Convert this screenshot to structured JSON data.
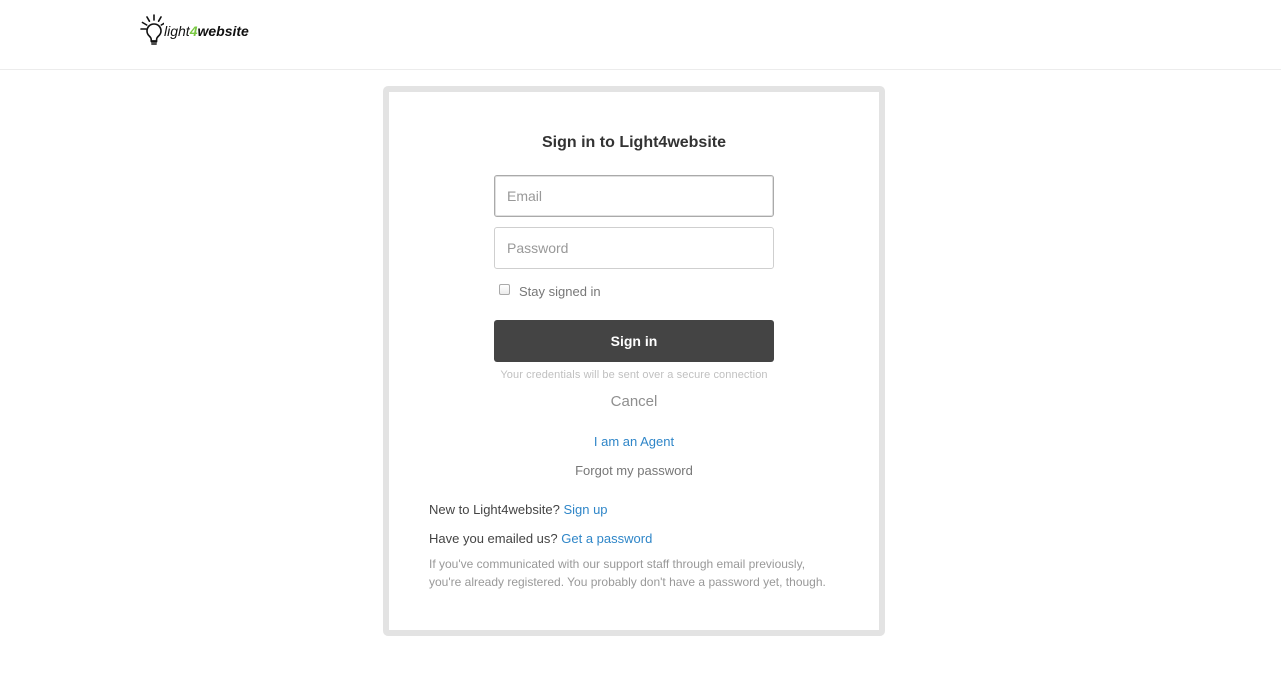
{
  "header": {
    "logo": {
      "text_light": "light",
      "text_four": "4",
      "text_website": "website",
      "icon": "lightbulb-icon"
    }
  },
  "login": {
    "title": "Sign in to Light4website",
    "email_placeholder": "Email",
    "email_value": "",
    "password_placeholder": "Password",
    "password_value": "",
    "stay_signed_in_label": "Stay signed in",
    "stay_signed_in_checked": false,
    "sign_in_label": "Sign in",
    "secure_note": "Your credentials will be sent over a secure connection",
    "cancel_label": "Cancel",
    "agent_link": "I am an Agent",
    "forgot_password_link": "Forgot my password",
    "new_text": "New to Light4website?",
    "sign_up_link": "Sign up",
    "emailed_text": "Have you emailed us?",
    "get_password_link": "Get a password",
    "help_line_1": "If you've communicated with our support staff through email previously,",
    "help_line_2": "you're already registered. You probably don't have a password yet, though."
  },
  "colors": {
    "button": "#444444",
    "link": "#2f86c8",
    "border": "#e3e3e3",
    "logo_accent": "#7ac943"
  }
}
